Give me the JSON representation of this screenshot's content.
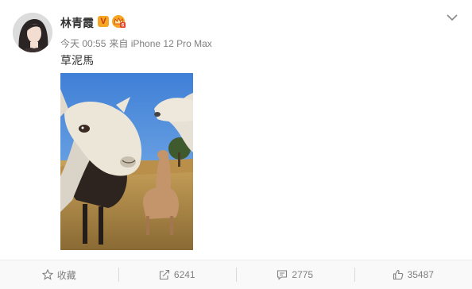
{
  "post": {
    "author": "林青霞",
    "verified_badge": "V",
    "timestamp": "今天 00:55",
    "source": "来自 iPhone 12 Pro Max",
    "text": "草泥馬",
    "image_description_icon": "alpaca-photo"
  },
  "actions": {
    "favorite_label": "收藏",
    "repost_count": "6241",
    "comment_count": "2775",
    "like_count": "35487"
  },
  "icons": {
    "more": "chevron-down-icon",
    "favorite": "star-icon",
    "repost": "share-icon",
    "comment": "comment-icon",
    "like": "thumbs-up-icon"
  },
  "colors": {
    "accent_gold": "#f5a623",
    "verified_v": "#c8370f",
    "muted_text": "#808080"
  }
}
